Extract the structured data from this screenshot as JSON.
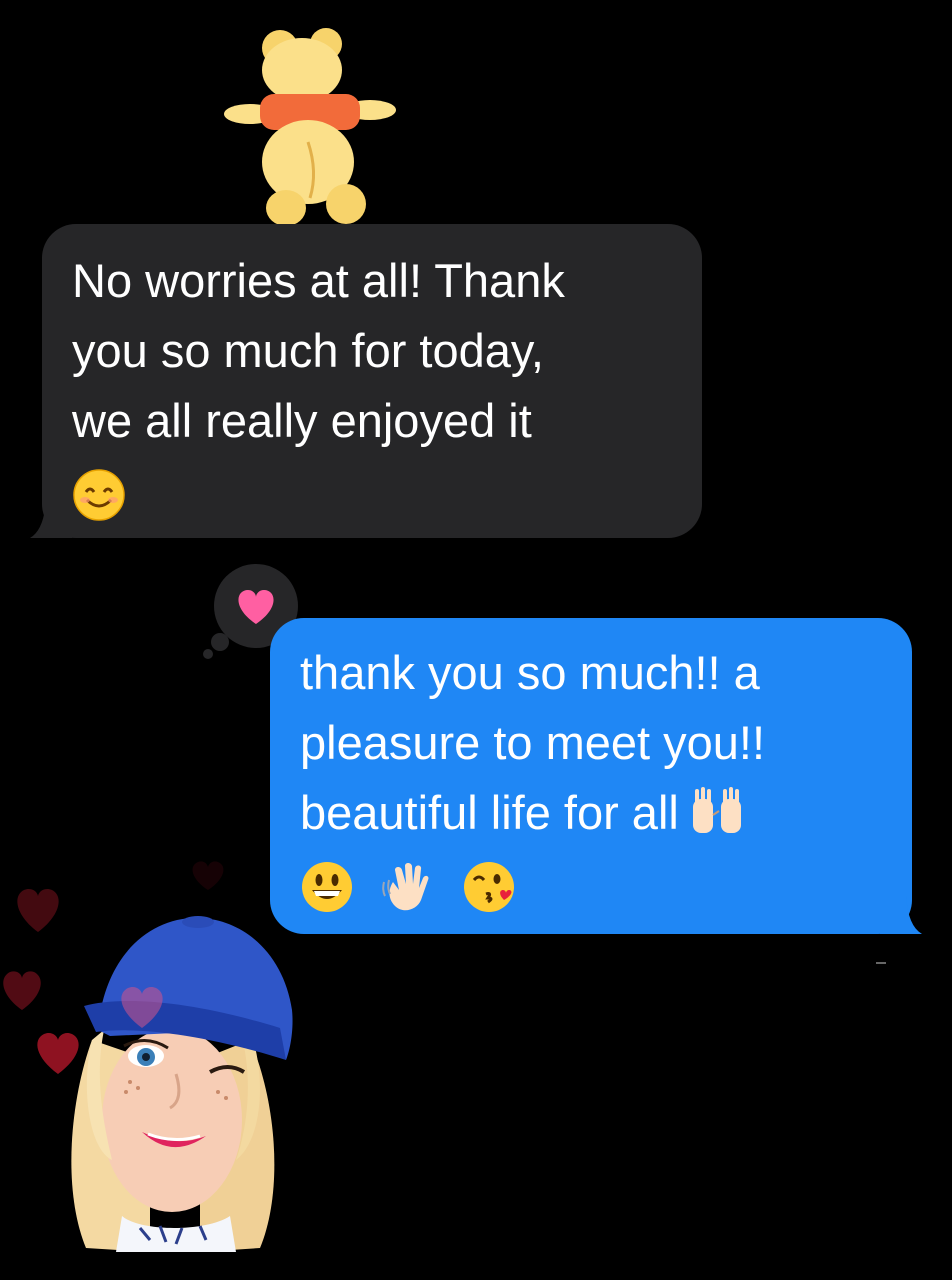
{
  "conversation": {
    "messages": [
      {
        "direction": "incoming",
        "lines": [
          "No worries at all! Thank",
          "you so much for today,",
          "we all really enjoyed it"
        ],
        "emojis": [
          "smiling-face-icon"
        ]
      },
      {
        "direction": "outgoing",
        "lines": [
          "thank you so much!!  a",
          "pleasure to meet you!!",
          "beautiful life for all"
        ],
        "inline_emoji": "raising-hands-icon",
        "emojis": [
          "grinning-face-icon",
          "waving-hand-icon",
          "face-blowing-kiss-icon"
        ],
        "reaction": "heart-icon"
      }
    ],
    "stickers": [
      "winnie-the-pooh-sticker",
      "memoji-sticker"
    ]
  },
  "colors": {
    "background": "#000000",
    "incoming_bubble": "#262628",
    "outgoing_bubble": "#1f87f5",
    "reaction_heart": "#ff5fa2"
  }
}
